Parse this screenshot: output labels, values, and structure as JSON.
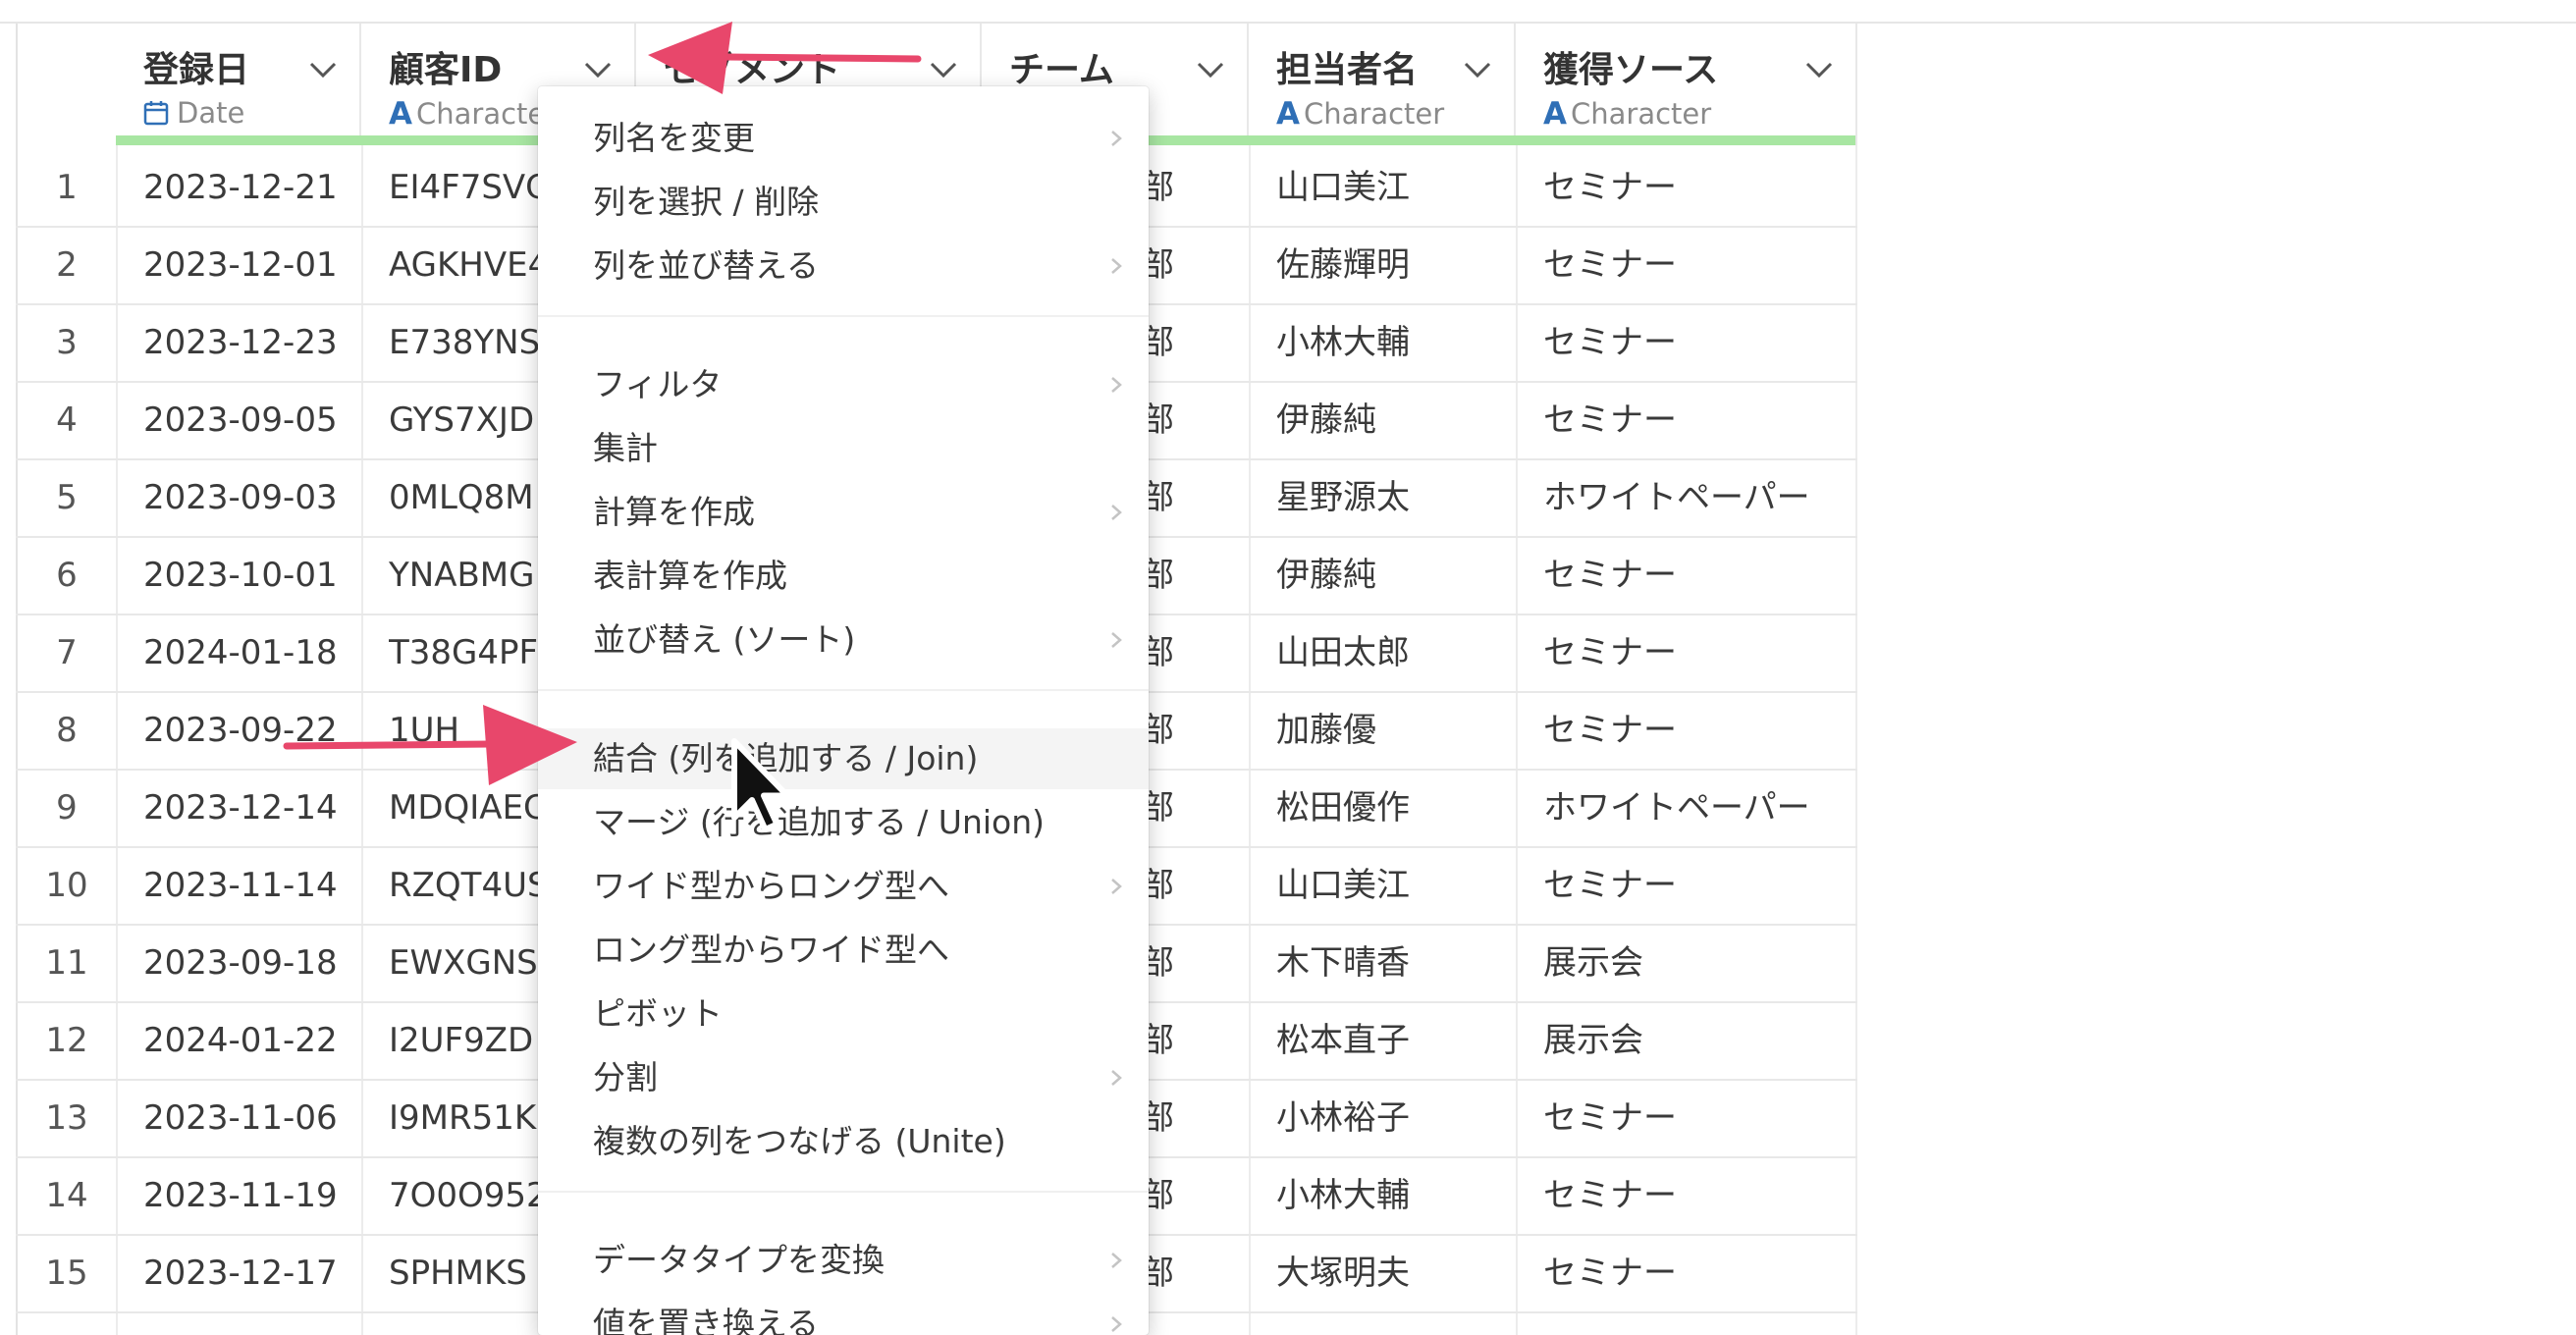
{
  "columns": [
    {
      "title": "登録日",
      "type_label": "Date",
      "type_icon": "calendar-icon"
    },
    {
      "title": "顧客ID",
      "type_label": "Characte",
      "type_icon": "character-type-icon"
    },
    {
      "title": "セグメント",
      "type_label": "",
      "type_icon": ""
    },
    {
      "title": "チーム",
      "type_label": "er",
      "type_icon": ""
    },
    {
      "title": "担当者名",
      "type_label": "Character",
      "type_icon": "character-type-icon"
    },
    {
      "title": "獲得ソース",
      "type_label": "Character",
      "type_icon": "character-type-icon"
    }
  ],
  "type_letter": "A",
  "rows": [
    {
      "n": "1",
      "date": "2023-12-21",
      "id": "EI4F7SVC",
      "team": "部",
      "person": "山口美江",
      "source": "セミナー"
    },
    {
      "n": "2",
      "date": "2023-12-01",
      "id": "AGKHVE4",
      "team": "部",
      "person": "佐藤輝明",
      "source": "セミナー"
    },
    {
      "n": "3",
      "date": "2023-12-23",
      "id": "E738YNS",
      "team": "部",
      "person": "小林大輔",
      "source": "セミナー"
    },
    {
      "n": "4",
      "date": "2023-09-05",
      "id": "GYS7XJD",
      "team": "部",
      "person": "伊藤純",
      "source": "セミナー"
    },
    {
      "n": "5",
      "date": "2023-09-03",
      "id": "0MLQ8M",
      "team": "部",
      "person": "星野源太",
      "source": "ホワイトペーパー"
    },
    {
      "n": "6",
      "date": "2023-10-01",
      "id": "YNABMG",
      "team": "部",
      "person": "伊藤純",
      "source": "セミナー"
    },
    {
      "n": "7",
      "date": "2024-01-18",
      "id": "T38G4PF",
      "team": "部",
      "person": "山田太郎",
      "source": "セミナー"
    },
    {
      "n": "8",
      "date": "2023-09-22",
      "id": "1UH",
      "team": "部",
      "person": "加藤優",
      "source": "セミナー"
    },
    {
      "n": "9",
      "date": "2023-12-14",
      "id": "MDQIAEC",
      "team": "部",
      "person": "松田優作",
      "source": "ホワイトペーパー"
    },
    {
      "n": "10",
      "date": "2023-11-14",
      "id": "RZQT4US",
      "team": "部",
      "person": "山口美江",
      "source": "セミナー"
    },
    {
      "n": "11",
      "date": "2023-09-18",
      "id": "EWXGNS",
      "team": "部",
      "person": "木下晴香",
      "source": "展示会"
    },
    {
      "n": "12",
      "date": "2024-01-22",
      "id": "I2UF9ZD",
      "team": "部",
      "person": "松本直子",
      "source": "展示会"
    },
    {
      "n": "13",
      "date": "2023-11-06",
      "id": "I9MR51K",
      "team": "部",
      "person": "小林裕子",
      "source": "セミナー"
    },
    {
      "n": "14",
      "date": "2023-11-19",
      "id": "7O0O952",
      "team": "部",
      "person": "小林大輔",
      "source": "セミナー"
    },
    {
      "n": "15",
      "date": "2023-12-17",
      "id": "SPHMKS",
      "team": "部",
      "person": "大塚明夫",
      "source": "セミナー"
    }
  ],
  "menu": {
    "groups": [
      [
        {
          "label": "列名を変更",
          "submenu": true
        },
        {
          "label": "列を選択 / 削除",
          "submenu": false
        },
        {
          "label": "列を並び替える",
          "submenu": true
        }
      ],
      [
        {
          "label": "フィルタ",
          "submenu": true
        },
        {
          "label": "集計",
          "submenu": false
        },
        {
          "label": "計算を作成",
          "submenu": true
        },
        {
          "label": "表計算を作成",
          "submenu": false
        },
        {
          "label": "並び替え (ソート)",
          "submenu": true
        }
      ],
      [
        {
          "label": "結合 (列を追加する / Join)",
          "submenu": false,
          "hover": true
        },
        {
          "label": "マージ (行を追加する / Union)",
          "submenu": false
        },
        {
          "label": "ワイド型からロング型へ",
          "submenu": true
        },
        {
          "label": "ロング型からワイド型へ",
          "submenu": false
        },
        {
          "label": "ピボット",
          "submenu": false
        },
        {
          "label": "分割",
          "submenu": true
        },
        {
          "label": "複数の列をつなげる (Unite)",
          "submenu": false
        }
      ],
      [
        {
          "label": "データタイプを変換",
          "submenu": true
        },
        {
          "label": "値を置き換える",
          "submenu": true
        }
      ]
    ]
  },
  "colors": {
    "accent_arrow": "#e8476b",
    "green_bar": "#a8e6a2",
    "type_icon": "#2f6fb6"
  }
}
